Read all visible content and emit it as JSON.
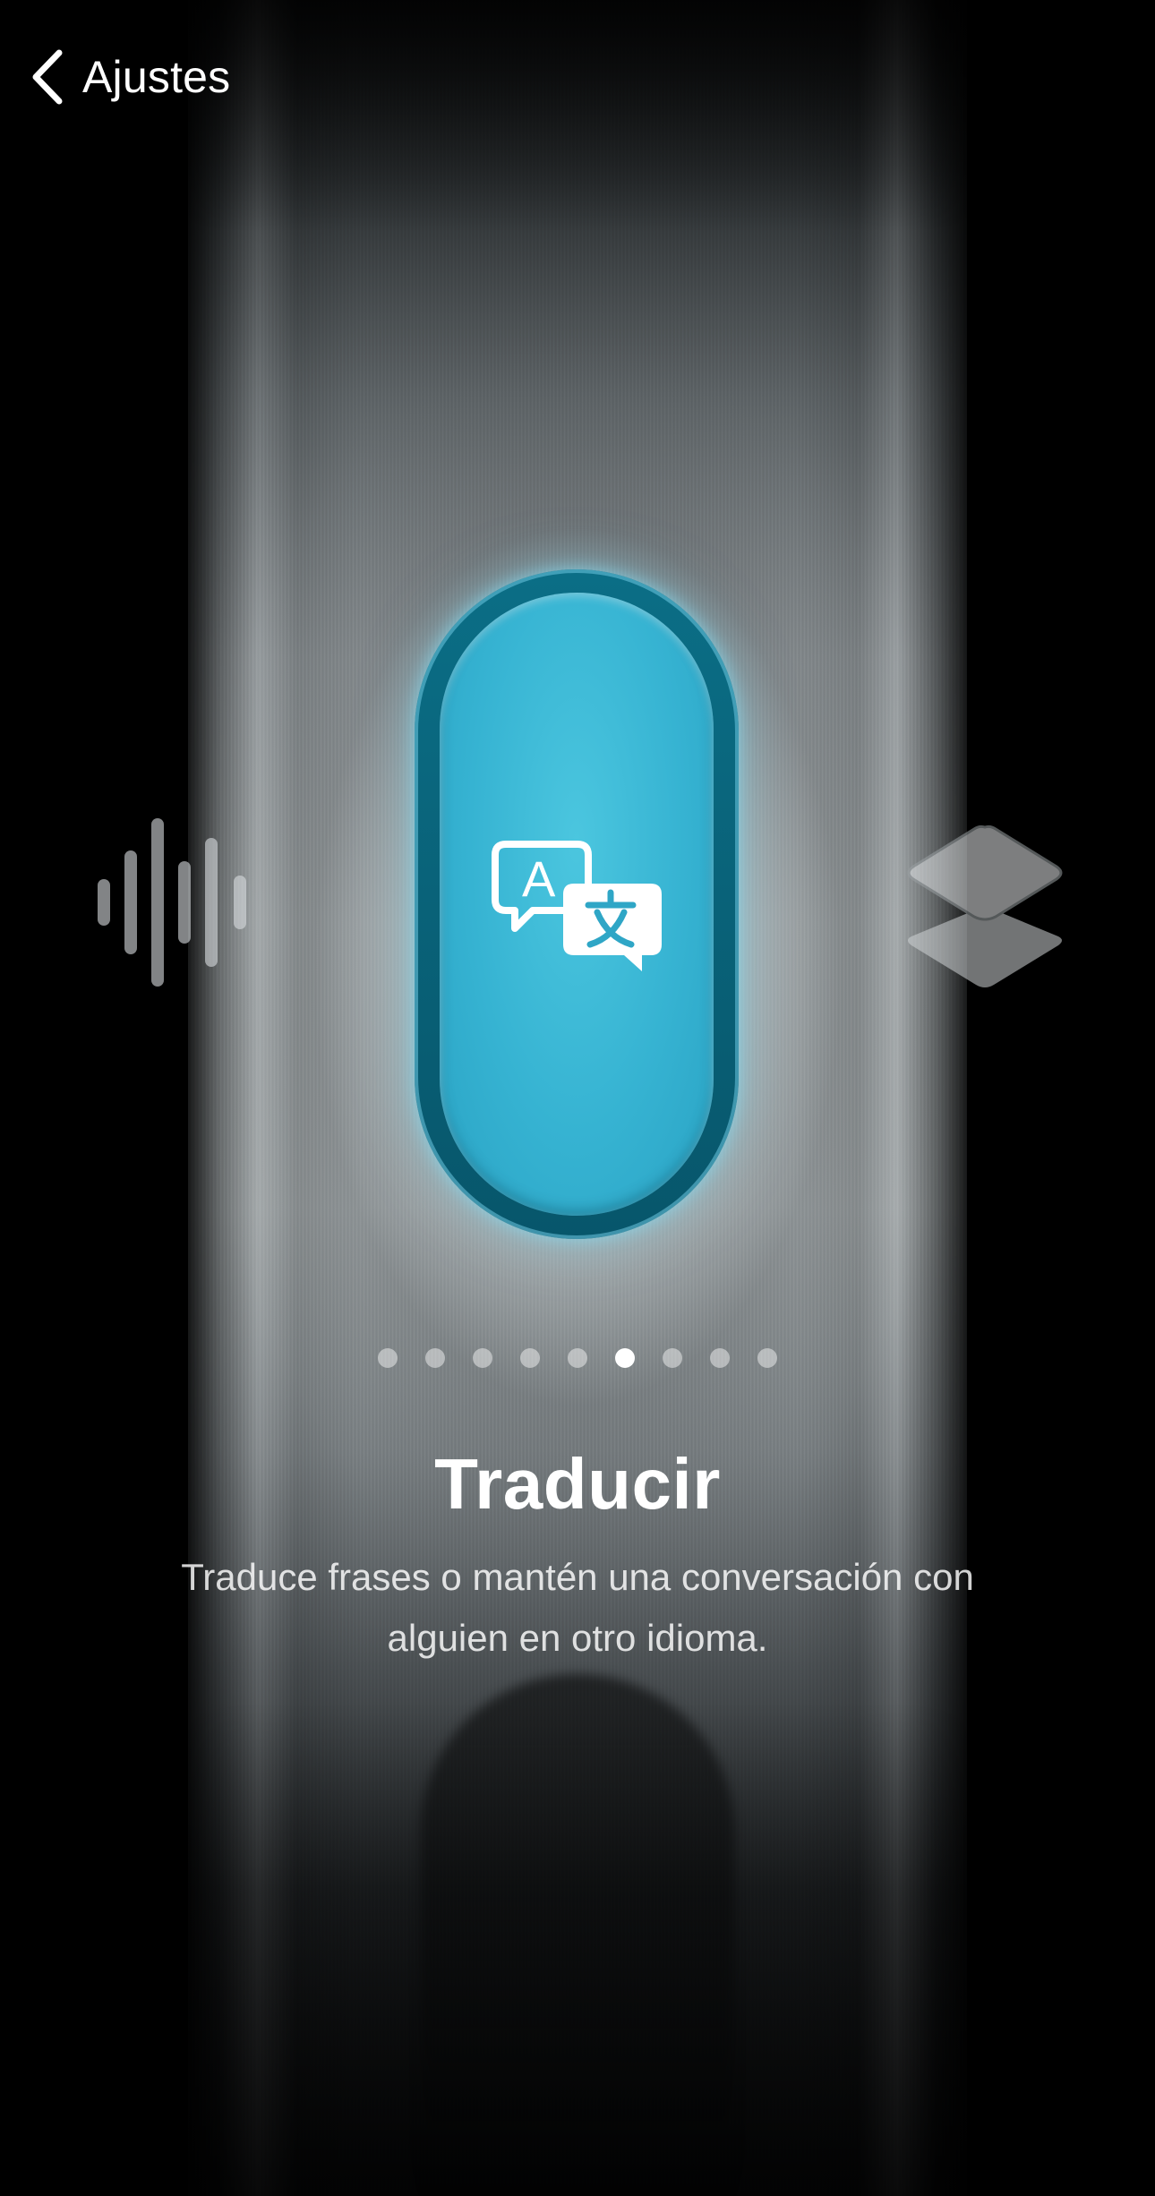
{
  "nav": {
    "back_label": "Ajustes"
  },
  "feature": {
    "title": "Traducir",
    "description": "Traduce frases o mantén una conversación con alguien en otro idioma."
  },
  "pager": {
    "total": 9,
    "active_index": 5
  },
  "icons": {
    "center": "translate-icon",
    "left": "waveform-icon",
    "right": "layers-icon",
    "back": "chevron-left-icon"
  },
  "colors": {
    "accent": "#38b4d3",
    "accent_dark": "#07566b"
  }
}
